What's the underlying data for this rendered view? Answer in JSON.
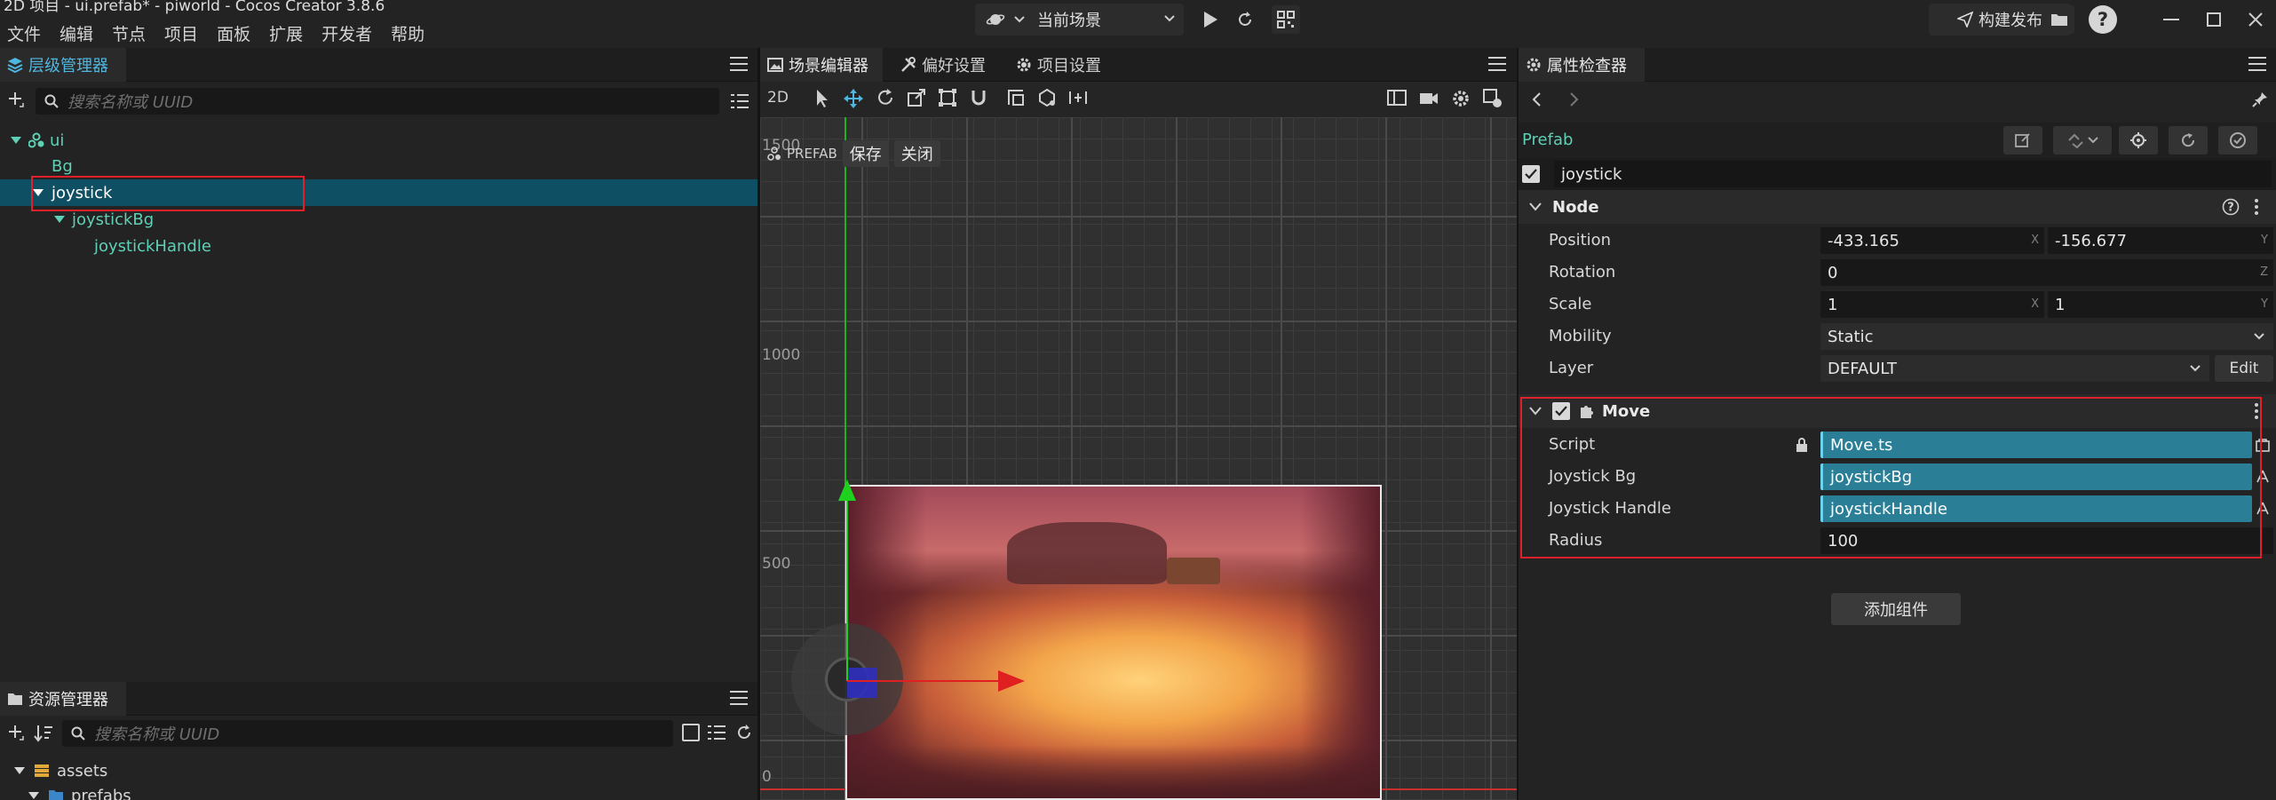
{
  "window": {
    "title": "2D 项目 - ui.prefab* - piworld - Cocos Creator 3.8.6",
    "menu": [
      "文件",
      "编辑",
      "节点",
      "项目",
      "面板",
      "扩展",
      "开发者",
      "帮助"
    ],
    "scene_select": "当前场景",
    "build_label": "构建发布"
  },
  "hierarchy": {
    "tab_label": "层级管理器",
    "search_placeholder": "搜索名称或 UUID",
    "nodes": [
      {
        "label": "ui",
        "depth": 0
      },
      {
        "label": "Bg",
        "depth": 1
      },
      {
        "label": "joystick",
        "depth": 1,
        "selected": true
      },
      {
        "label": "joystickBg",
        "depth": 2
      },
      {
        "label": "joystickHandle",
        "depth": 3
      }
    ]
  },
  "assets": {
    "tab_label": "资源管理器",
    "search_placeholder": "搜索名称或 UUID",
    "items": [
      "assets",
      "prefabs"
    ]
  },
  "scene": {
    "tabs": [
      "场景编辑器",
      "偏好设置",
      "项目设置"
    ],
    "mode_2d": "2D",
    "prefab_label": "PREFAB",
    "save_label": "保存",
    "close_label": "关闭",
    "ruler_labels": [
      "1500",
      "1000",
      "500",
      "0"
    ]
  },
  "inspector": {
    "tab_label": "属性检查器",
    "prefab_label": "Prefab",
    "node_name": "joystick",
    "node_section": "Node",
    "props": {
      "position_label": "Position",
      "position_x": "-433.165",
      "position_y": "-156.677",
      "rotation_label": "Rotation",
      "rotation": "0",
      "scale_label": "Scale",
      "scale_x": "1",
      "scale_y": "1",
      "mobility_label": "Mobility",
      "mobility": "Static",
      "layer_label": "Layer",
      "layer": "DEFAULT",
      "edit_label": "Edit"
    },
    "component": {
      "name": "Move",
      "script_label": "Script",
      "script": "Move.ts",
      "joystick_bg_label": "Joystick Bg",
      "joystick_bg": "joystickBg",
      "joystick_handle_label": "Joystick Handle",
      "joystick_handle": "joystickHandle",
      "radius_label": "Radius",
      "radius": "100"
    },
    "add_component_label": "添加组件"
  },
  "colors": {
    "accent": "#2a7f97",
    "selection": "#0f4f63",
    "highlight_box": "#e0202a",
    "tree_text": "#5fd0b5"
  }
}
